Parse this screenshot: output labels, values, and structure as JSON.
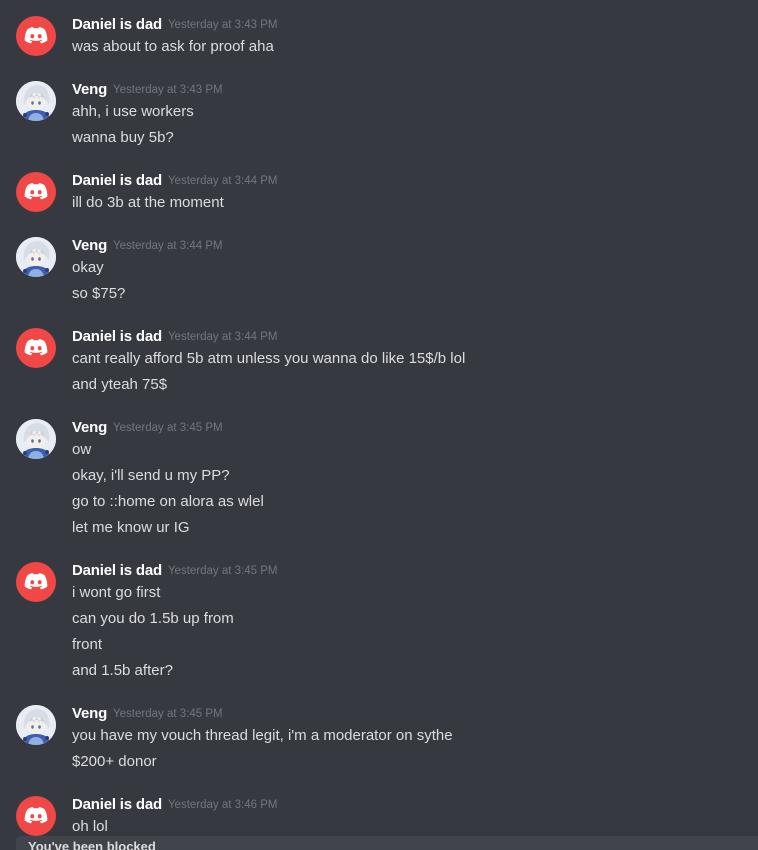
{
  "messages": [
    {
      "author": "Daniel is dad",
      "timestamp": "Yesterday at 3:43 PM",
      "avatar": "discord-logo-icon",
      "lines": [
        "was about to ask for proof aha"
      ]
    },
    {
      "author": "Veng",
      "timestamp": "Yesterday at 3:43 PM",
      "avatar": "anime-character-icon",
      "lines": [
        "ahh, i use workers",
        "wanna buy 5b?"
      ]
    },
    {
      "author": "Daniel is dad",
      "timestamp": "Yesterday at 3:44 PM",
      "avatar": "discord-logo-icon",
      "lines": [
        "ill do 3b at the moment"
      ]
    },
    {
      "author": "Veng",
      "timestamp": "Yesterday at 3:44 PM",
      "avatar": "anime-character-icon",
      "lines": [
        "okay",
        "so $75?"
      ]
    },
    {
      "author": "Daniel is dad",
      "timestamp": "Yesterday at 3:44 PM",
      "avatar": "discord-logo-icon",
      "lines": [
        "cant really afford 5b atm unless you wanna do like 15$/b lol",
        "and yteah 75$"
      ]
    },
    {
      "author": "Veng",
      "timestamp": "Yesterday at 3:45 PM",
      "avatar": "anime-character-icon",
      "lines": [
        "ow",
        "okay, i'll send u my PP?",
        "go to ::home on alora as wlel",
        "let me know ur IG"
      ]
    },
    {
      "author": "Daniel is dad",
      "timestamp": "Yesterday at 3:45 PM",
      "avatar": "discord-logo-icon",
      "lines": [
        "i wont go first",
        "can you do 1.5b up from",
        "front",
        "and 1.5b after?"
      ]
    },
    {
      "author": "Veng",
      "timestamp": "Yesterday at 3:45 PM",
      "avatar": "anime-character-icon",
      "lines": [
        "you have my vouch thread legit, i'm a moderator on sythe",
        "$200+ donor"
      ]
    },
    {
      "author": "Daniel is dad",
      "timestamp": "Yesterday at 3:46 PM",
      "avatar": "discord-logo-icon",
      "lines": [
        "oh lol"
      ]
    }
  ],
  "footer": {
    "text": "You've been blocked"
  },
  "colors": {
    "background": "#36393f",
    "discord_red": "#f04747",
    "username": "#ffffff",
    "timestamp": "#72767d",
    "message_text": "#dcddde"
  }
}
